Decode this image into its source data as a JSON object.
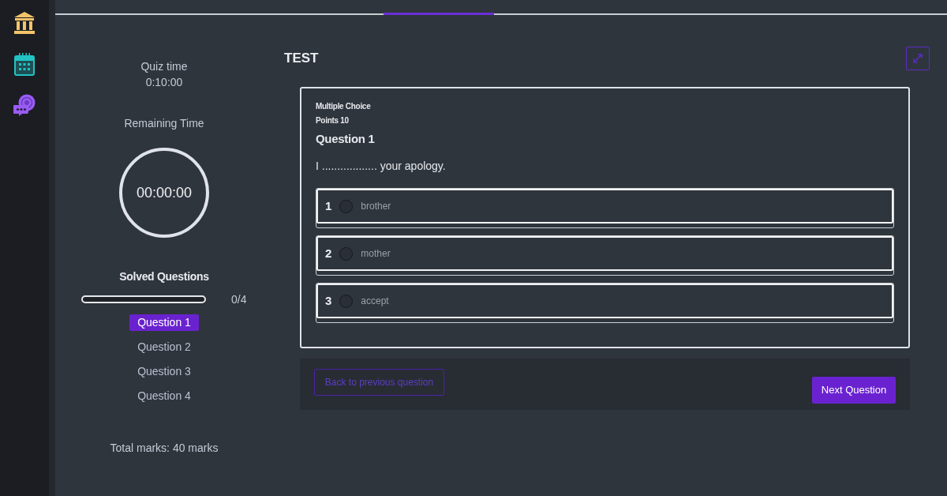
{
  "quiz_panel": {
    "quiz_time": {
      "label": "Quiz time",
      "value": "0:10:00"
    },
    "remaining_time": {
      "label": "Remaining Time",
      "value": "00:00:00"
    },
    "solved_questions": {
      "label": "Solved Questions",
      "level": 0,
      "count": "0/4"
    },
    "questions": [
      {
        "label": "Question 1",
        "selected": true
      },
      {
        "label": "Question 2",
        "selected": false
      },
      {
        "label": "Question 3",
        "selected": false
      },
      {
        "label": "Question 4",
        "selected": false
      }
    ],
    "total_marks": "Total marks: 40 marks"
  },
  "quiz": {
    "title": "TEST",
    "question": {
      "type": "Multiple Choice",
      "points": "Points 10",
      "title": "Question 1",
      "text": "I .................. your apology.",
      "options": [
        {
          "number": "1",
          "label": "brother",
          "checked": false
        },
        {
          "number": "2",
          "label": "mother",
          "checked": false
        },
        {
          "number": "3",
          "label": "accept",
          "checked": false
        }
      ]
    },
    "buttons": [
      {
        "label": "Back to previous question",
        "disabled": true
      },
      {
        "label": "Next Question",
        "disabled": false
      }
    ]
  }
}
